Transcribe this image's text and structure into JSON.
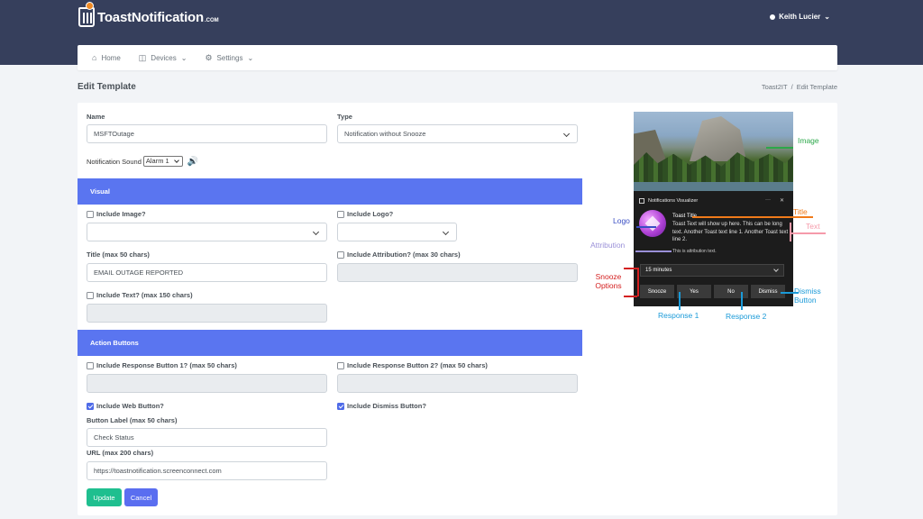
{
  "brand": {
    "name": "ToastNotification",
    "suffix": ".COM"
  },
  "user": {
    "name": "Keith Lucier"
  },
  "nav": [
    {
      "label": "Home",
      "icon": "home-icon"
    },
    {
      "label": "Devices",
      "icon": "devices-icon"
    },
    {
      "label": "Settings",
      "icon": "gear-icon"
    }
  ],
  "page": {
    "title": "Edit Template"
  },
  "breadcrumb": {
    "parent": "Toast2IT",
    "separator": "/",
    "current": "Edit Template"
  },
  "form": {
    "name_label": "Name",
    "name_value": "MSFTOutage",
    "type_label": "Type",
    "type_value": "Notification without Snooze",
    "sound_label": "Notification Sound",
    "sound_value": "Alarm 1",
    "visual_header": "Visual",
    "include_image": "Include Image?",
    "include_logo": "Include Logo?",
    "title_label": "Title (max 50 chars)",
    "title_value": "EMAIL OUTAGE REPORTED",
    "include_attribution": "Include Attribution? (max 30 chars)",
    "include_text": "Include Text? (max 150 chars)",
    "actions_header": "Action Buttons",
    "include_response1": "Include Response Button 1? (max 50 chars)",
    "include_response2": "Include Response Button 2? (max 50 chars)",
    "include_web": "Include Web Button?",
    "include_web_checked": true,
    "include_dismiss": "Include Dismiss Button?",
    "include_dismiss_checked": true,
    "button_label_label": "Button Label (max 50 chars)",
    "button_label_value": "Check Status",
    "url_label": "URL (max 200 chars)",
    "url_value": "https://toastnotification.screenconnect.com",
    "update": "Update",
    "cancel": "Cancel"
  },
  "preview": {
    "window_title": "Notifications Visualizer",
    "toast_title": "Toast Title",
    "toast_text": "Toast Text will show up here. This can be long text. Another Toast text line 1. Another Toast text line 2.",
    "attribution": "This is attribution text.",
    "snooze_value": "15 minutes",
    "buttons": [
      "Snooze",
      "Yes",
      "No",
      "Dismiss"
    ]
  },
  "annotations": {
    "image": "Image",
    "title": "Title",
    "text": "Text",
    "logo": "Logo",
    "attribution": "Attribution",
    "snooze": "Snooze Options",
    "response1": "Response 1",
    "response2": "Response 2",
    "dismiss": "Dismiss Button"
  },
  "colors": {
    "header_bg": "#363f5c",
    "section_band": "#5a75f0",
    "update_button": "#1fbf8f",
    "cancel_button": "#5a6ef0",
    "anno_green": "#2ca84a",
    "anno_orange": "#f07a1a",
    "anno_pink": "#f59aaa",
    "anno_blue": "#3a4ec4",
    "anno_lavender": "#9a90d8",
    "anno_red": "#d42020",
    "anno_cyan": "#1a9ad8"
  }
}
